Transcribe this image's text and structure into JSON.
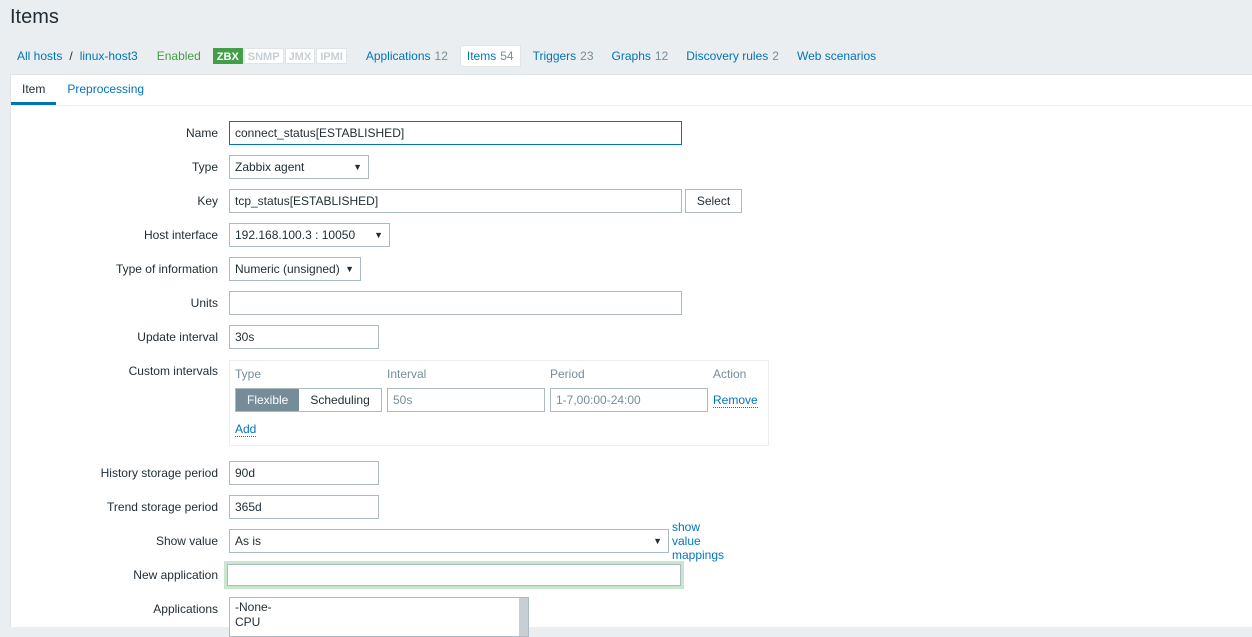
{
  "page": {
    "title": "Items"
  },
  "nav": {
    "all_hosts": "All hosts",
    "separator": "/",
    "host": "linux-host3",
    "status": "Enabled",
    "badges": [
      "ZBX",
      "SNMP",
      "JMX",
      "IPMI"
    ],
    "applications": {
      "label": "Applications",
      "count": "12"
    },
    "items": {
      "label": "Items",
      "count": "54"
    },
    "triggers": {
      "label": "Triggers",
      "count": "23"
    },
    "graphs": {
      "label": "Graphs",
      "count": "12"
    },
    "discovery": {
      "label": "Discovery rules",
      "count": "2"
    },
    "web": {
      "label": "Web scenarios"
    }
  },
  "tabs": [
    "Item",
    "Preprocessing"
  ],
  "form": {
    "name": {
      "label": "Name",
      "value": "connect_status[ESTABLISHED]"
    },
    "type": {
      "label": "Type",
      "value": "Zabbix agent"
    },
    "key": {
      "label": "Key",
      "value": "tcp_status[ESTABLISHED]",
      "button": "Select"
    },
    "host_interface": {
      "label": "Host interface",
      "value": "192.168.100.3 : 10050"
    },
    "type_of_info": {
      "label": "Type of information",
      "value": "Numeric (unsigned)"
    },
    "units": {
      "label": "Units",
      "value": ""
    },
    "update_interval": {
      "label": "Update interval",
      "value": "30s"
    },
    "custom_intervals": {
      "label": "Custom intervals",
      "headers": {
        "type": "Type",
        "interval": "Interval",
        "period": "Period",
        "action": "Action"
      },
      "row": {
        "flexible": "Flexible",
        "scheduling": "Scheduling",
        "interval_placeholder": "50s",
        "period_value": "1-7,00:00-24:00",
        "remove": "Remove"
      },
      "add": "Add"
    },
    "history": {
      "label": "History storage period",
      "value": "90d"
    },
    "trend": {
      "label": "Trend storage period",
      "value": "365d"
    },
    "show_value": {
      "label": "Show value",
      "value": "As is",
      "link": "show value mappings"
    },
    "new_application": {
      "label": "New application",
      "value": ""
    },
    "applications": {
      "label": "Applications",
      "options": [
        "-None-",
        "CPU"
      ]
    }
  },
  "colors": {
    "accent": "#0275b8",
    "enabled": "#429e47",
    "focus_glow": "#c9e7cc"
  }
}
